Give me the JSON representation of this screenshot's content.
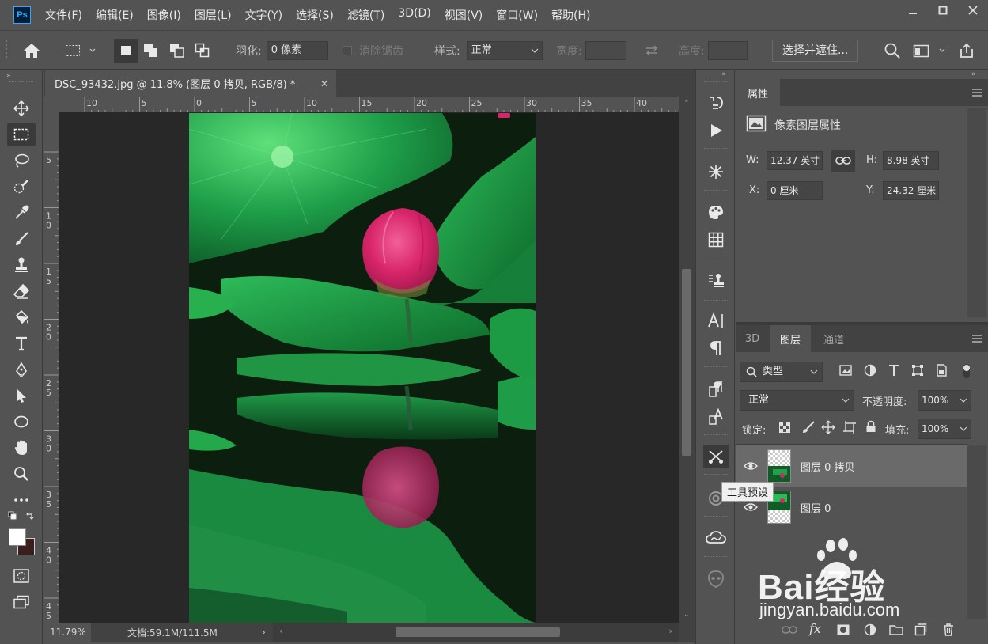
{
  "app": {
    "logo": "Ps"
  },
  "menu": [
    "文件(F)",
    "编辑(E)",
    "图像(I)",
    "图层(L)",
    "文字(Y)",
    "选择(S)",
    "滤镜(T)",
    "3D(D)",
    "视图(V)",
    "窗口(W)",
    "帮助(H)"
  ],
  "options": {
    "feather_label": "羽化:",
    "feather_value": "0 像素",
    "antialias_label": "消除锯齿",
    "style_label": "样式:",
    "style_value": "正常",
    "width_label": "宽度:",
    "height_label": "高度:",
    "select_mask_label": "选择并遮住..."
  },
  "document": {
    "tab_title": "DSC_93432.jpg @ 11.8% (图层 0 拷贝, RGB/8) *",
    "ruler_top": [
      "10",
      "5",
      "0",
      "5",
      "10",
      "15",
      "20",
      "25",
      "30",
      "35",
      "40"
    ],
    "ruler_left": [
      "5",
      "1\n0",
      "1\n5",
      "2\n0",
      "2\n5",
      "3\n0",
      "3\n5",
      "4\n0",
      "4\n5"
    ],
    "zoom": "11.79%",
    "doc_info": "文档:59.1M/111.5M"
  },
  "properties": {
    "tab_label": "属性",
    "section_title": "像素图层属性",
    "w_label": "W:",
    "w_value": "12.37 英寸",
    "h_label": "H:",
    "h_value": "8.98 英寸",
    "x_label": "X:",
    "x_value": "0 厘米",
    "y_label": "Y:",
    "y_value": "24.32 厘米"
  },
  "layers_panel": {
    "tabs": [
      "3D",
      "图层",
      "通道"
    ],
    "active_tab": "图层",
    "filter_value": "类型",
    "blend_mode": "正常",
    "opacity_label": "不透明度:",
    "opacity_value": "100%",
    "lock_label": "锁定:",
    "fill_label": "填充:",
    "fill_value": "100%",
    "layers": [
      {
        "name": "图层 0 拷贝",
        "selected": true
      },
      {
        "name": "图层 0",
        "selected": false
      }
    ]
  },
  "tooltip": "工具预设",
  "watermark": {
    "brand": "Bai经验",
    "url": "jingyan.baidu.com"
  },
  "colors": {
    "accent": "#31a8ff",
    "panel": "#535353",
    "dark": "#424242",
    "canvas": "#282828"
  }
}
